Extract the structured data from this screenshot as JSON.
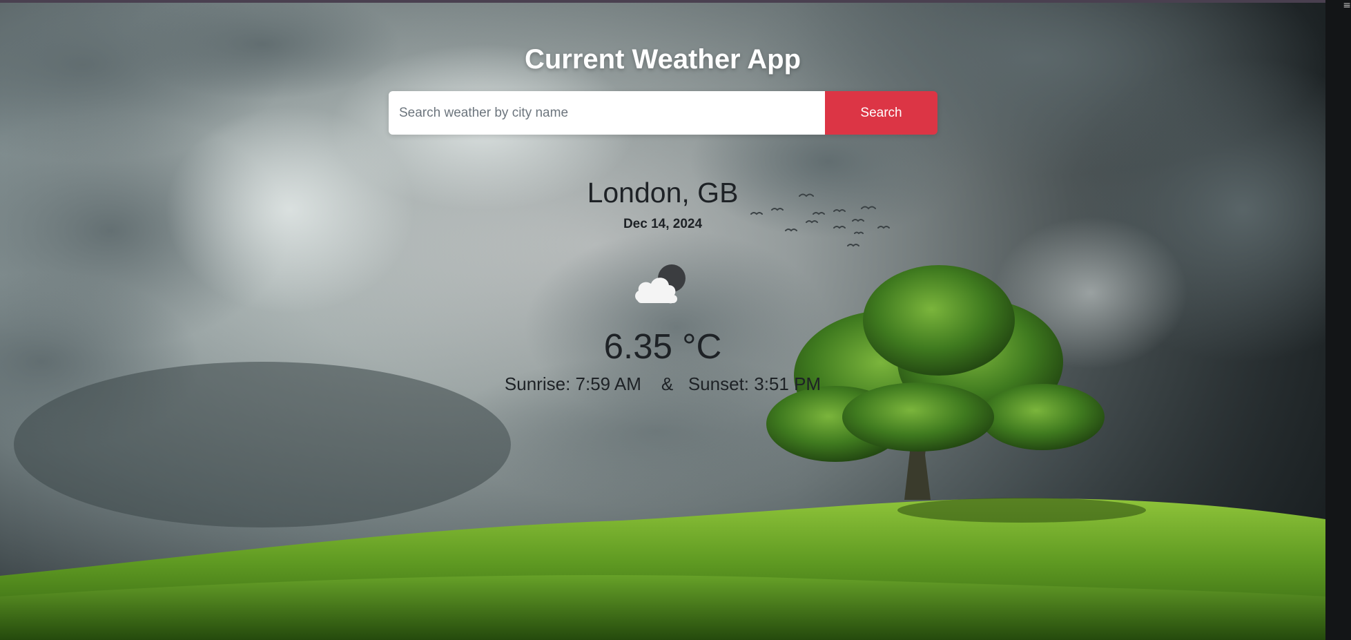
{
  "app": {
    "title": "Current Weather App"
  },
  "search": {
    "placeholder": "Search weather by city name",
    "value": "",
    "button_label": "Search"
  },
  "weather": {
    "location": "London, GB",
    "date": "Dec 14, 2024",
    "icon": "partly-cloudy-night-icon",
    "temperature": "6.35 °C",
    "sunrise": "Sunrise: 7:59 AM",
    "separator": "&",
    "sunset": "Sunset: 3:51 PM"
  },
  "colors": {
    "accent_button": "#dc3545",
    "title_text": "#ffffff",
    "body_text": "#1e2226"
  }
}
